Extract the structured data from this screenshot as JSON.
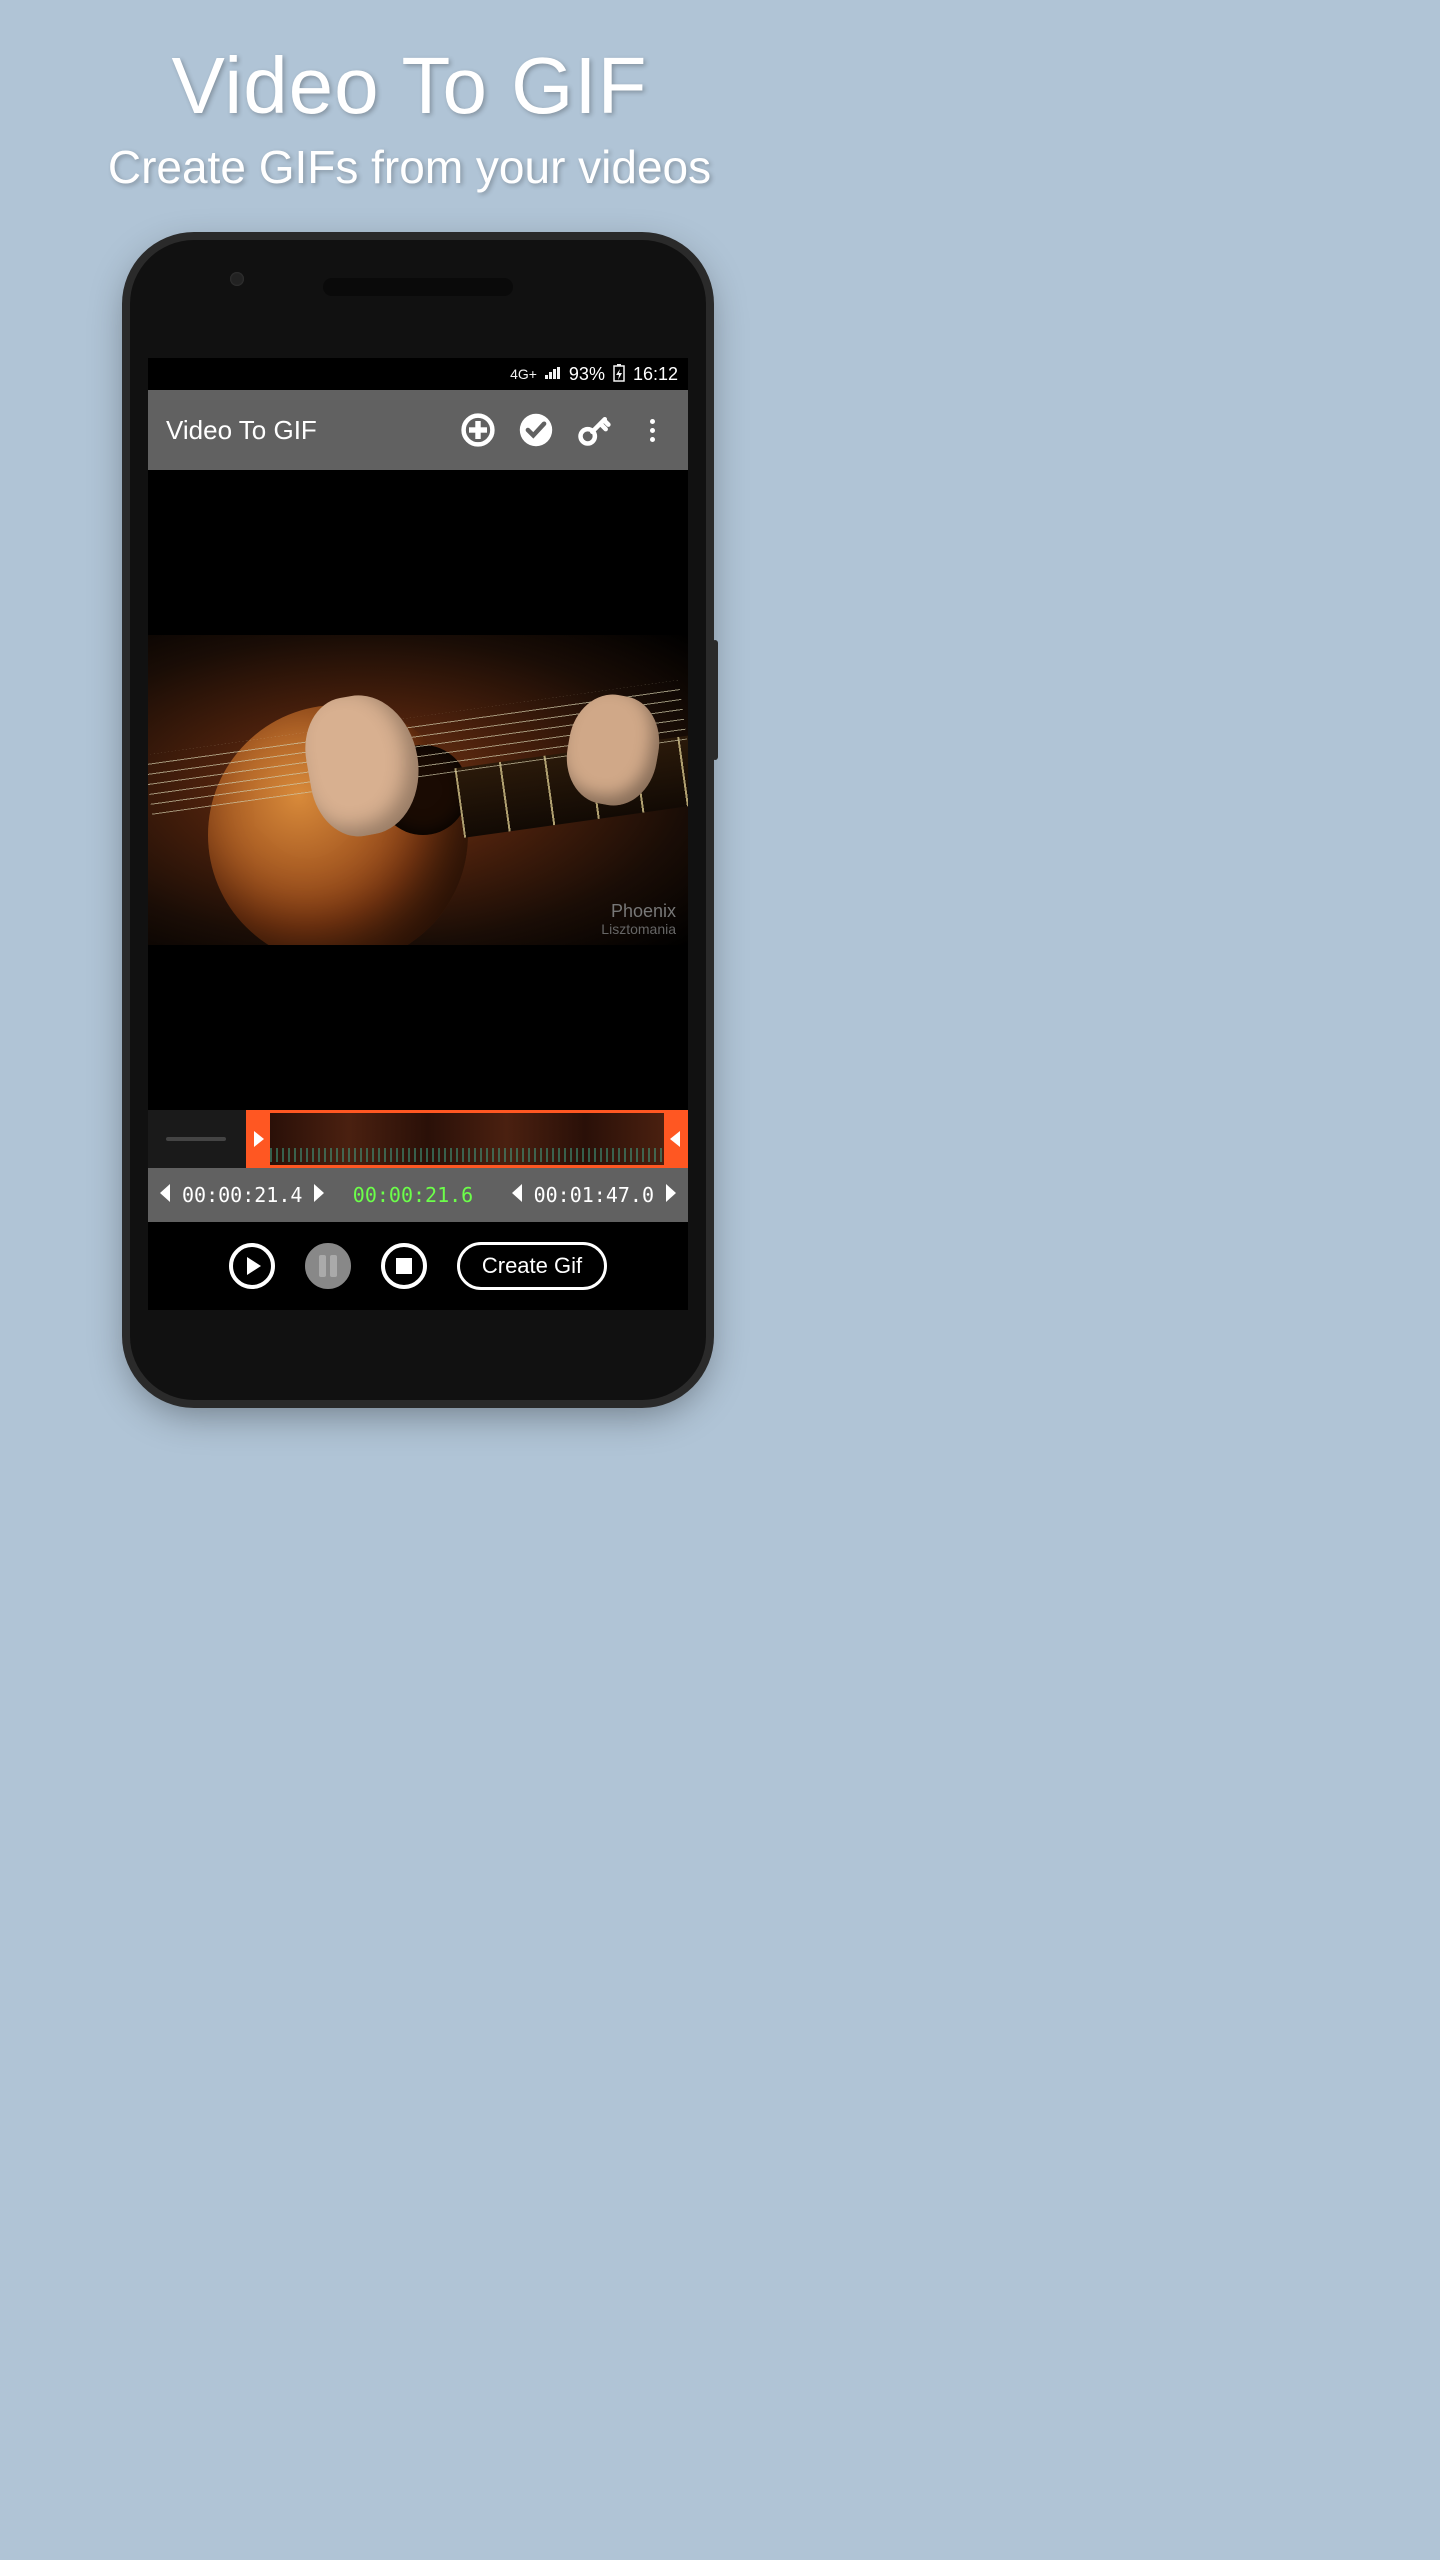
{
  "promo": {
    "title": "Video To GIF",
    "subtitle": "Create GIFs from your videos"
  },
  "statusbar": {
    "network": "4G+",
    "battery_text": "93%",
    "time": "16:12"
  },
  "appbar": {
    "title": "Video To GIF"
  },
  "watermark": {
    "line1": "Phoenix",
    "line2": "Lisztomania"
  },
  "times": {
    "start": "00:00:21.4",
    "current": "00:00:21.6",
    "end": "00:01:47.0"
  },
  "controls": {
    "create_gif_label": "Create Gif"
  }
}
